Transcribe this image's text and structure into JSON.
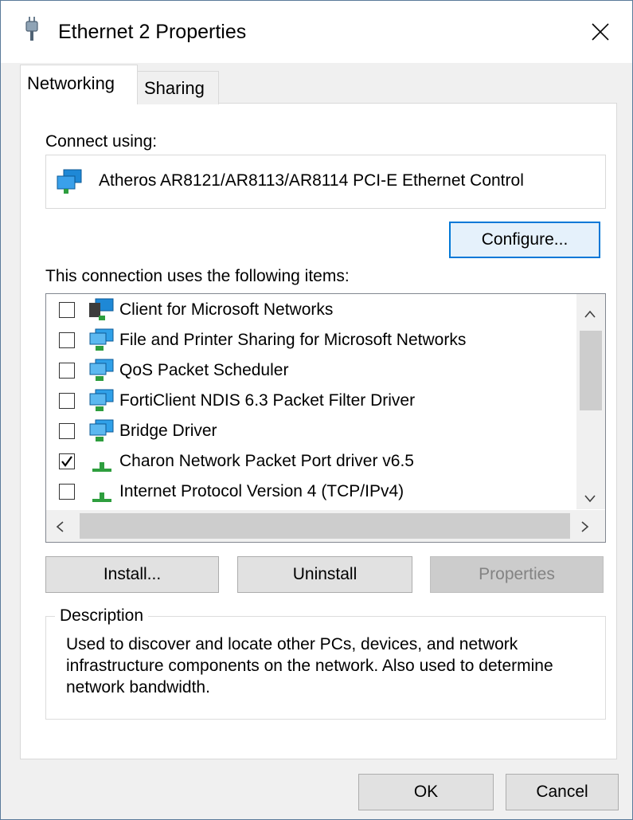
{
  "window": {
    "title": "Ethernet 2 Properties",
    "close_symbol": "✕"
  },
  "tabs": [
    {
      "label": "Networking",
      "active": true
    },
    {
      "label": "Sharing",
      "active": false
    }
  ],
  "connect_using_label": "Connect using:",
  "adapter": {
    "name": "Atheros AR8121/AR8113/AR8114 PCI-E Ethernet Control",
    "icon": "network-adapter-icon"
  },
  "configure_label": "Configure...",
  "items_label": "This connection uses the following items:",
  "items": [
    {
      "label": "Client for Microsoft Networks",
      "checked": false,
      "icon": "network-client-icon"
    },
    {
      "label": "File and Printer Sharing for Microsoft Networks",
      "checked": false,
      "icon": "network-service-icon"
    },
    {
      "label": "QoS Packet Scheduler",
      "checked": false,
      "icon": "network-service-icon"
    },
    {
      "label": "FortiClient NDIS 6.3 Packet Filter Driver",
      "checked": false,
      "icon": "network-service-icon"
    },
    {
      "label": "Bridge Driver",
      "checked": false,
      "icon": "network-service-icon"
    },
    {
      "label": "Charon Network Packet Port driver v6.5",
      "checked": true,
      "icon": "protocol-icon"
    },
    {
      "label": "Internet Protocol Version 4 (TCP/IPv4)",
      "checked": false,
      "icon": "protocol-icon"
    }
  ],
  "buttons": {
    "install": "Install...",
    "uninstall": "Uninstall",
    "properties": "Properties",
    "ok": "OK",
    "cancel": "Cancel"
  },
  "description": {
    "legend": "Description",
    "text": "Used to discover and locate other PCs, devices, and network infrastructure components on the network.  Also used to determine network bandwidth."
  },
  "colors": {
    "focus_border": "#0078d7",
    "adapter_blue": "#1e88d6",
    "protocol_green": "#2e9e3e"
  }
}
